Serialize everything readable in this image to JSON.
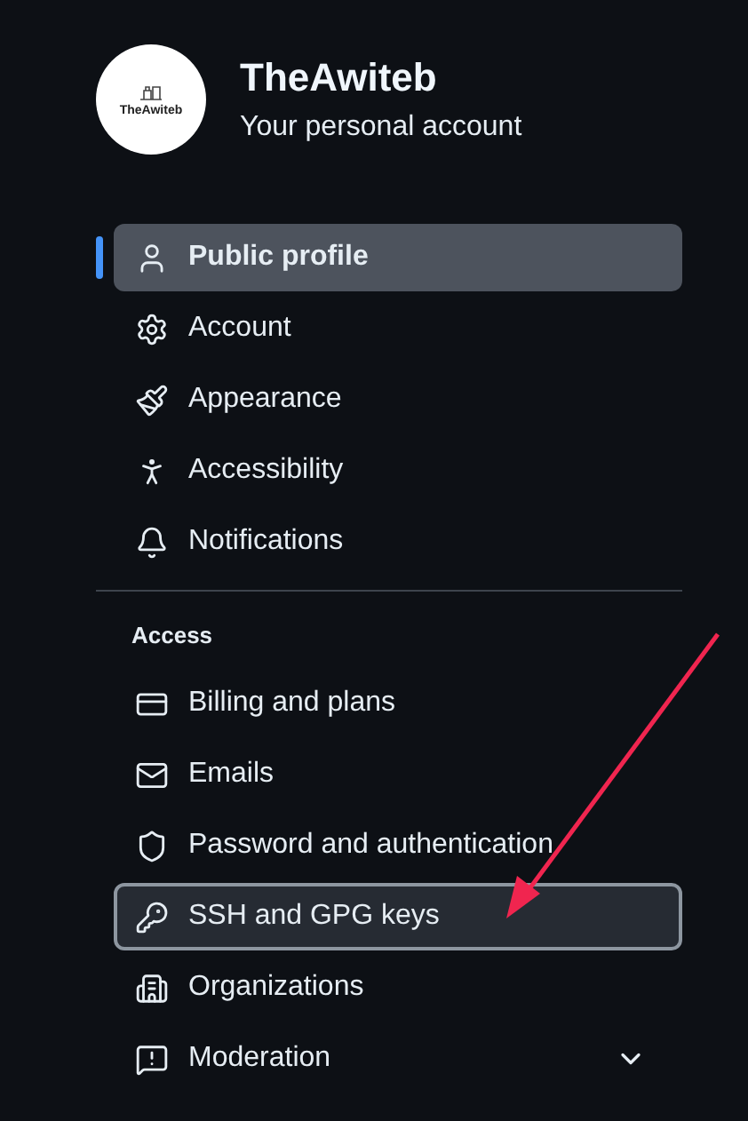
{
  "account": {
    "avatar_text": "TheAwiteb",
    "name": "TheAwiteb",
    "subtitle": "Your personal account"
  },
  "sections": [
    {
      "items": [
        {
          "label": "Public profile",
          "selected": true,
          "focused": false
        },
        {
          "label": "Account",
          "selected": false,
          "focused": false
        },
        {
          "label": "Appearance",
          "selected": false,
          "focused": false
        },
        {
          "label": "Accessibility",
          "selected": false,
          "focused": false
        },
        {
          "label": "Notifications",
          "selected": false,
          "focused": false
        }
      ]
    },
    {
      "heading": "Access",
      "items": [
        {
          "label": "Billing and plans",
          "selected": false,
          "focused": false
        },
        {
          "label": "Emails",
          "selected": false,
          "focused": false
        },
        {
          "label": "Password and authentication",
          "selected": false,
          "focused": false
        },
        {
          "label": "SSH and GPG keys",
          "selected": false,
          "focused": true
        },
        {
          "label": "Organizations",
          "selected": false,
          "focused": false
        },
        {
          "label": "Moderation",
          "selected": false,
          "focused": false,
          "expanded": false
        }
      ]
    }
  ]
}
